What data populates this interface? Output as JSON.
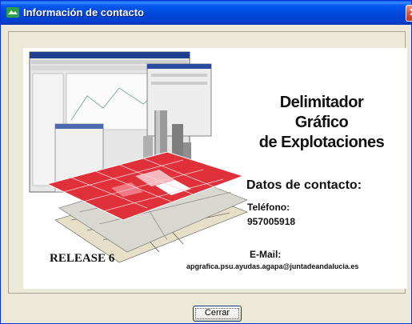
{
  "window": {
    "title": "Información de contacto"
  },
  "product": {
    "name_line1": "Delimitador Gráfico",
    "name_line2": "de Explotaciones",
    "release": "RELEASE 6"
  },
  "contact": {
    "heading": "Datos de contacto:",
    "phone_label": "Teléfono:",
    "phone": "957005918",
    "email_label": "E-Mail:",
    "email": "apgrafica.psu.ayudas.agapa@juntadeandalucia.es"
  },
  "buttons": {
    "close": "Cerrar"
  },
  "colors": {
    "titlebar": "#0046D6",
    "map_red": "#E0303A",
    "close_red": "#D6563A"
  }
}
